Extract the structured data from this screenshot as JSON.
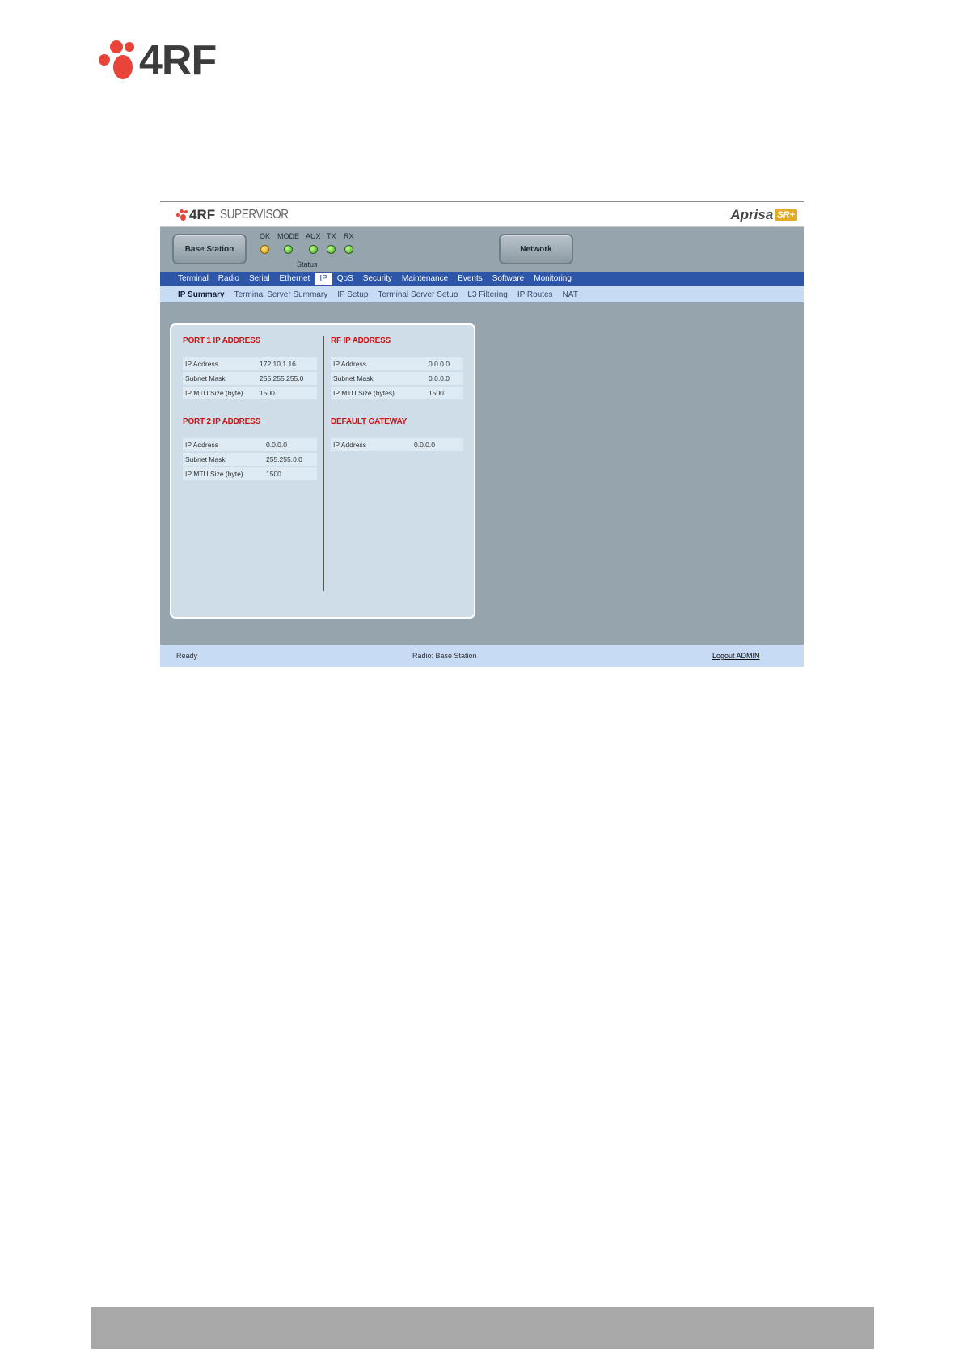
{
  "document": {
    "brand": "4RF"
  },
  "app": {
    "supervisor_brand": "4RF",
    "supervisor_title": "SUPERVISOR",
    "product_name": "Aprisa",
    "product_badge": "SR+"
  },
  "header": {
    "base_station_button": "Base Station",
    "network_button": "Network",
    "leds": [
      {
        "label": "OK",
        "color": "amber"
      },
      {
        "label": "MODE",
        "color": "green"
      },
      {
        "label": "AUX",
        "color": "green"
      },
      {
        "label": "TX",
        "color": "green"
      },
      {
        "label": "RX",
        "color": "green"
      }
    ],
    "status_label": "Status"
  },
  "menu": {
    "items": [
      "Terminal",
      "Radio",
      "Serial",
      "Ethernet",
      "IP",
      "QoS",
      "Security",
      "Maintenance",
      "Events",
      "Software",
      "Monitoring"
    ],
    "active": "IP"
  },
  "submenu": {
    "items": [
      "IP Summary",
      "Terminal Server Summary",
      "IP Setup",
      "Terminal Server Setup",
      "L3 Filtering",
      "IP Routes",
      "NAT"
    ],
    "active": "IP Summary"
  },
  "port1": {
    "title": "PORT 1 IP ADDRESS",
    "rows": [
      {
        "label": "IP Address",
        "value": "172.10.1.16"
      },
      {
        "label": "Subnet Mask",
        "value": "255.255.255.0"
      },
      {
        "label": "IP MTU Size (byte)",
        "value": "1500"
      }
    ]
  },
  "port2": {
    "title": "PORT 2 IP ADDRESS",
    "rows": [
      {
        "label": "IP Address",
        "value": "0.0.0.0"
      },
      {
        "label": "Subnet Mask",
        "value": "255.255.0.0"
      },
      {
        "label": "IP MTU Size (byte)",
        "value": "1500"
      }
    ]
  },
  "rf": {
    "title": "RF IP ADDRESS",
    "rows": [
      {
        "label": "IP Address",
        "value": "0.0.0.0"
      },
      {
        "label": "Subnet Mask",
        "value": "0.0.0.0"
      },
      {
        "label": "IP MTU Size (bytes)",
        "value": "1500"
      }
    ]
  },
  "gateway": {
    "title": "DEFAULT GATEWAY",
    "rows": [
      {
        "label": "IP Address",
        "value": "0.0.0.0"
      }
    ]
  },
  "footer": {
    "status": "Ready",
    "radio": "Radio: Base Station",
    "logout": "Logout ADMIN"
  }
}
